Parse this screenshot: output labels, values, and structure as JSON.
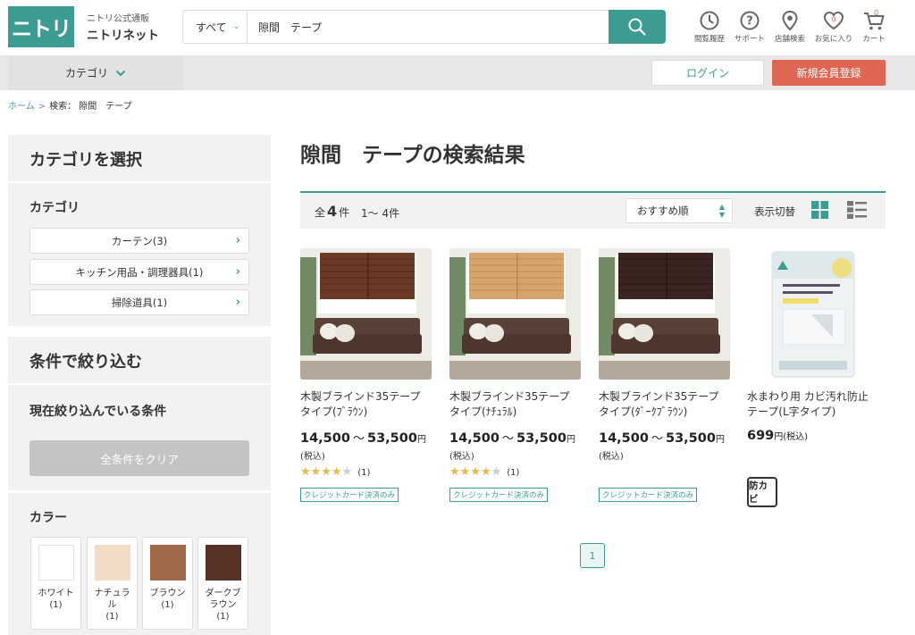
{
  "header": {
    "logo_text": "ニトリ",
    "brand_sub": "ニトリ公式通販",
    "brand_main": "ニトリネット",
    "search_scope": "すべて",
    "search_value": "隙間　テープ",
    "icons": [
      {
        "label": "閲覧履歴",
        "icon": "history-icon"
      },
      {
        "label": "サポート",
        "icon": "help-icon"
      },
      {
        "label": "店舗検索",
        "icon": "map-pin-icon"
      },
      {
        "label": "お気に入り",
        "icon": "heart-icon",
        "badge": "0"
      },
      {
        "label": "カート",
        "icon": "cart-icon",
        "badge": "0"
      }
    ]
  },
  "nav": {
    "category_label": "カテゴリ",
    "login_label": "ログイン",
    "register_label": "新規会員登録"
  },
  "breadcrumb": {
    "home": "ホーム",
    "sep": ">",
    "current": "検索：  隙間　テープ"
  },
  "sidebar": {
    "select_category_title": "カテゴリを選択",
    "category_heading": "カテゴリ",
    "categories": [
      {
        "label": "カーテン(3)"
      },
      {
        "label": "キッチン用品・調理器具(1)"
      },
      {
        "label": "掃除道具(1)"
      }
    ],
    "filter_title": "条件で絞り込む",
    "current_filter_heading": "現在絞り込んでいる条件",
    "clear_label": "全条件をクリア",
    "color_heading": "カラー",
    "colors": [
      {
        "name": "ホワイト",
        "count": "(1)",
        "hex": "#ffffff"
      },
      {
        "name": "ナチュラル",
        "count": "(1)",
        "hex": "#f1dcc8"
      },
      {
        "name": "ブラウン",
        "count": "(1)",
        "hex": "#a0694a"
      },
      {
        "name": "ダークブラウン",
        "count": "(1)",
        "hex": "#553427"
      }
    ]
  },
  "main": {
    "title": "隙間　テープの検索結果",
    "count_prefix": "全",
    "count_num": "4",
    "count_suffix": "件",
    "range": "1～ 4件",
    "sort_label": "おすすめ順",
    "view_label": "表示切替"
  },
  "products": [
    {
      "name": "木製ブラインド35テープタイプ(ﾌﾞﾗｳﾝ)",
      "price_from": "14,500",
      "tilde": "～",
      "price_to": "53,500",
      "yen": "円",
      "tax": "(税込)",
      "rating": 4,
      "reviews": "(1)",
      "badge": "クレジットカード決済のみ",
      "blind_color": "#6b3a25"
    },
    {
      "name": "木製ブラインド35テープタイプ(ﾅﾁｭﾗﾙ)",
      "price_from": "14,500",
      "tilde": "～",
      "price_to": "53,500",
      "yen": "円",
      "tax": "(税込)",
      "rating": 4,
      "reviews": "(1)",
      "badge": "クレジットカード決済のみ",
      "blind_color": "#d7a56c"
    },
    {
      "name": "木製ブラインド35テープタイプ(ﾀﾞｰｸﾌﾞﾗｳﾝ)",
      "price_from": "14,500",
      "tilde": "～",
      "price_to": "53,500",
      "yen": "円",
      "tax": "(税込)",
      "badge": "クレジットカード決済のみ",
      "blind_color": "#3a2520"
    },
    {
      "name": "水まわり用 カビ汚れ防止テープ(L字タイプ)",
      "price": "699",
      "yen": "円",
      "tax": "(税込)",
      "badge": "防カビ"
    }
  ],
  "pagination": {
    "current": "1"
  },
  "colors": {
    "brand": "#3d9c92",
    "register": "#e06654",
    "star": "#e8b84a"
  }
}
